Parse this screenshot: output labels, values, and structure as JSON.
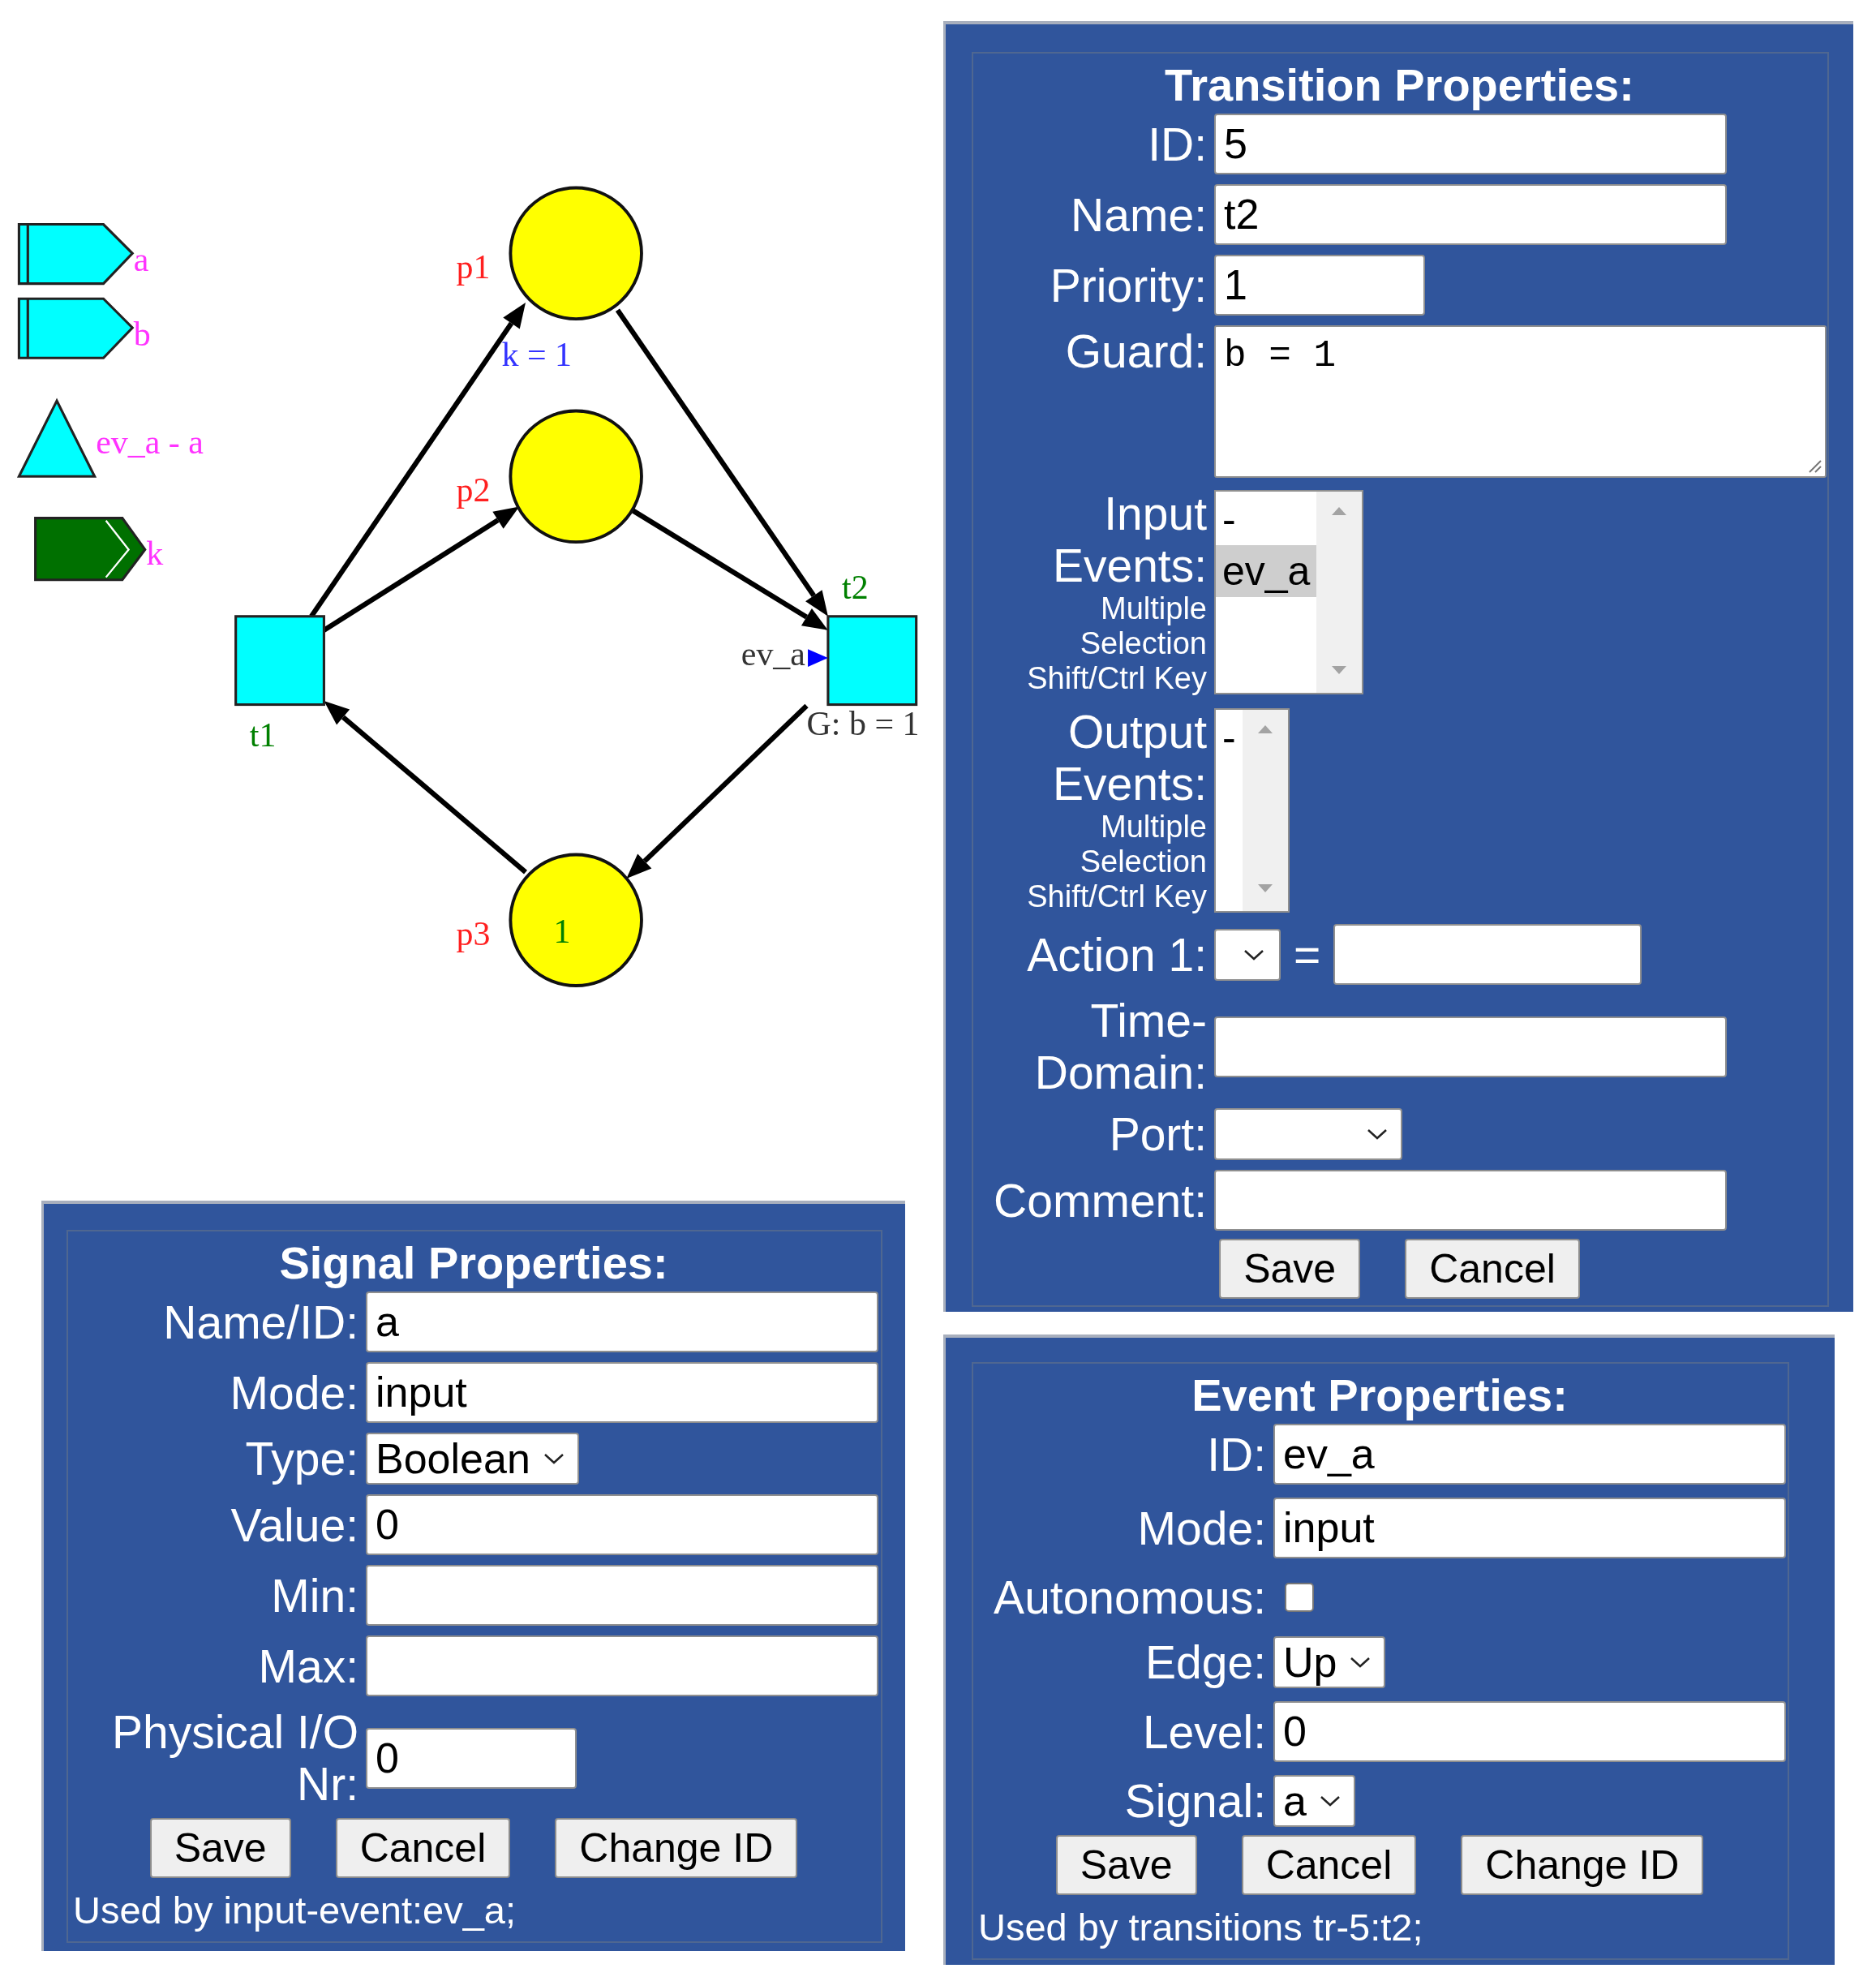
{
  "diagram": {
    "signals": [
      {
        "kind": "input",
        "label": "a"
      },
      {
        "kind": "input",
        "label": "b"
      },
      {
        "kind": "event",
        "label": "ev_a - a"
      },
      {
        "kind": "output",
        "label": "k"
      }
    ],
    "places": [
      {
        "label": "p1"
      },
      {
        "label": "p2"
      },
      {
        "label": "p3",
        "tokens": "1"
      }
    ],
    "transitions": [
      {
        "label": "t1"
      },
      {
        "label": "t2",
        "event": "ev_a",
        "guard": "G: b = 1"
      }
    ],
    "action_labels": [
      "k = 1"
    ]
  },
  "transition_panel": {
    "title": "Transition Properties:",
    "rows": [
      {
        "kind": "text",
        "label": "ID:",
        "value": "5"
      },
      {
        "kind": "text",
        "label": "Name:",
        "value": "t2"
      },
      {
        "kind": "short_text",
        "label": "Priority:",
        "value": "1"
      },
      {
        "kind": "textarea",
        "label": "Guard:",
        "value": "b = 1"
      },
      {
        "kind": "listbox",
        "label": "Input Events:",
        "note": "Multiple Selection Shift/Ctrl Key",
        "options": [
          {
            "label": "-",
            "selected": false
          },
          {
            "label": "ev_a",
            "selected": true
          }
        ]
      },
      {
        "kind": "listbox",
        "label": "Output Events:",
        "note": "Multiple Selection Shift/Ctrl Key",
        "options": [
          {
            "label": "-",
            "selected": false
          }
        ]
      },
      {
        "kind": "action",
        "label": "Action 1:",
        "operator": "="
      },
      {
        "kind": "text",
        "label": "Time-Domain:"
      },
      {
        "kind": "select",
        "label": "Port:"
      },
      {
        "kind": "text",
        "label": "Comment:"
      }
    ],
    "buttons": [
      "Save",
      "Cancel"
    ]
  },
  "signal_panel": {
    "title": "Signal Properties:",
    "rows": [
      {
        "kind": "text",
        "label": "Name/ID:",
        "value": "a"
      },
      {
        "kind": "text",
        "label": "Mode:",
        "value": "input"
      },
      {
        "kind": "select",
        "label": "Type:",
        "value": "Boolean"
      },
      {
        "kind": "text",
        "label": "Value:",
        "value": "0"
      },
      {
        "kind": "text",
        "label": "Min:"
      },
      {
        "kind": "text",
        "label": "Max:"
      },
      {
        "kind": "short_text",
        "label": "Physical I/O Nr:",
        "value": "0"
      }
    ],
    "buttons": [
      "Save",
      "Cancel",
      "Change ID"
    ],
    "footer": "Used by input-event:ev_a;"
  },
  "event_panel": {
    "title": "Event Properties:",
    "rows": [
      {
        "kind": "text",
        "label": "ID:",
        "value": "ev_a"
      },
      {
        "kind": "text",
        "label": "Mode:",
        "value": "input"
      },
      {
        "kind": "checkbox",
        "label": "Autonomous:",
        "checked": false
      },
      {
        "kind": "select",
        "label": "Edge:",
        "value": "Up"
      },
      {
        "kind": "text",
        "label": "Level:",
        "value": "0"
      },
      {
        "kind": "select",
        "label": "Signal:",
        "value": "a"
      }
    ],
    "buttons": [
      "Save",
      "Cancel",
      "Change ID"
    ],
    "footer": "Used by transitions tr-5:t2;"
  }
}
